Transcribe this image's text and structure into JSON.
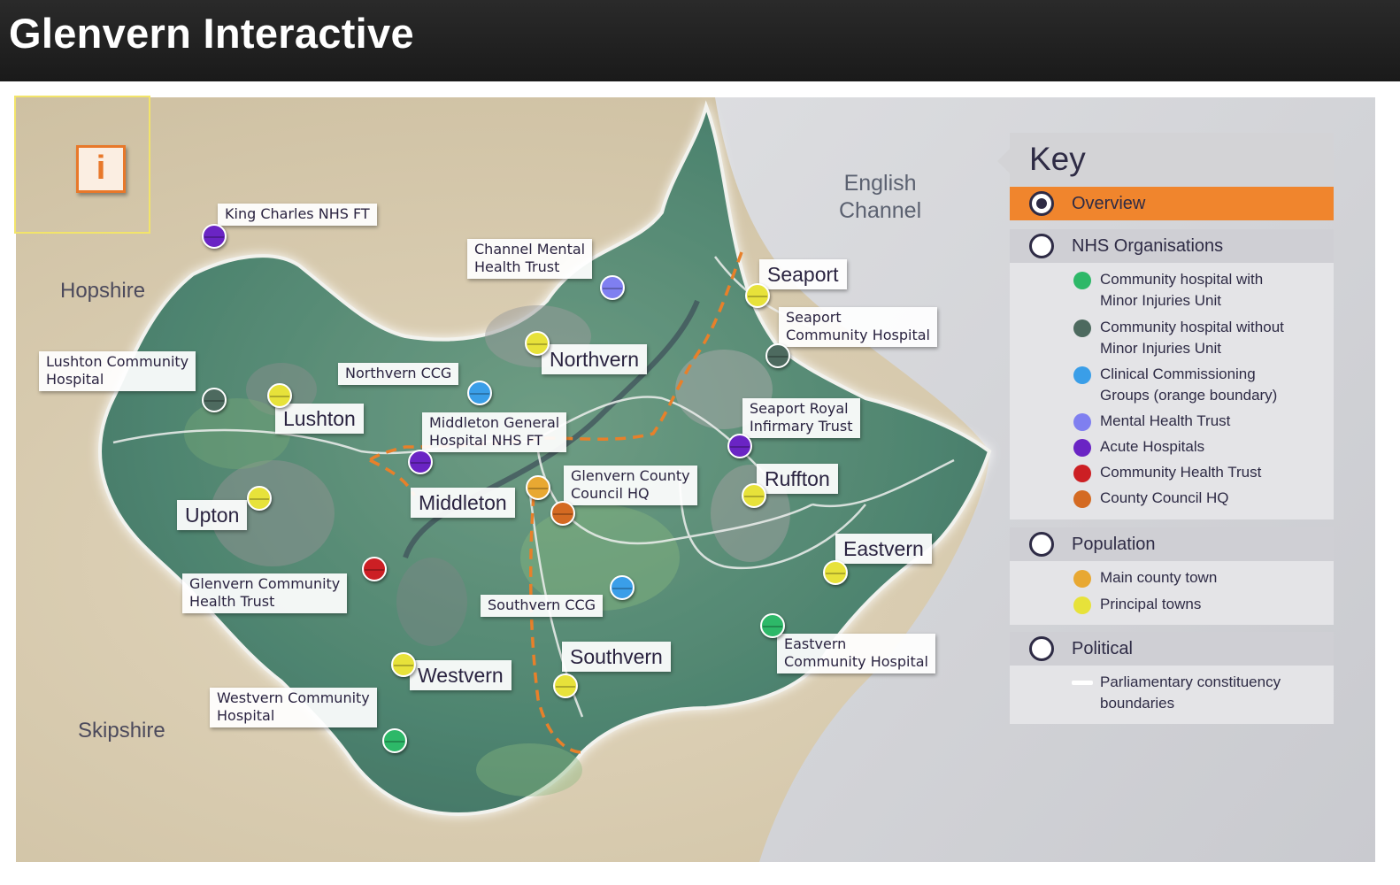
{
  "app": {
    "title": "Glenvern Interactive"
  },
  "map": {
    "info_button": "i",
    "sea_label": [
      "English",
      "Channel"
    ],
    "regions": {
      "hopshire": "Hopshire",
      "skipshire": "Skipshire"
    },
    "towns": {
      "seaport": "Seaport",
      "northvern": "Northvern",
      "lushton": "Lushton",
      "middleton": "Middleton",
      "upton": "Upton",
      "ruffton": "Ruffton",
      "eastvern": "Eastvern",
      "southvern": "Southvern",
      "westvern": "Westvern"
    },
    "orgs": {
      "king_charles": "King Charles NHS FT",
      "channel_mental": [
        "Channel Mental",
        "Health Trust"
      ],
      "seaport_community": [
        "Seaport",
        "Community Hospital"
      ],
      "lushton_community": [
        "Lushton Community",
        "Hospital"
      ],
      "northvern_ccg": "Northvern CCG",
      "middleton_general": [
        "Middleton General",
        "Hospital  NHS FT"
      ],
      "seaport_royal": [
        "Seaport Royal",
        "Infirmary Trust"
      ],
      "glenvern_county": [
        "Glenvern County",
        "Council HQ"
      ],
      "glenvern_community": [
        "Glenvern Community",
        "Health Trust"
      ],
      "southvern_ccg": "Southvern CCG",
      "eastvern_community": [
        "Eastvern",
        "Community Hospital"
      ],
      "westvern_community": [
        "Westvern Community",
        "Hospital"
      ]
    }
  },
  "key": {
    "title": "Key",
    "sections": {
      "overview": "Overview",
      "nhs": "NHS Organisations",
      "population": "Population",
      "political": "Political"
    },
    "nhs_items": [
      {
        "lines": [
          "Community hospital with",
          "Minor Injuries Unit"
        ],
        "color": "#2db868"
      },
      {
        "lines": [
          "Community hospital without",
          "Minor Injuries Unit"
        ],
        "color": "#4d6a5f"
      },
      {
        "lines": [
          "Clinical Commissioning",
          "Groups (orange boundary)"
        ],
        "color": "#3a9ee8"
      },
      {
        "lines": [
          "Mental Health Trust"
        ],
        "color": "#7f7ff0"
      },
      {
        "lines": [
          "Acute Hospitals"
        ],
        "color": "#6a24c4"
      },
      {
        "lines": [
          "Community Health Trust"
        ],
        "color": "#cc1f24"
      },
      {
        "lines": [
          "County Council HQ"
        ],
        "color": "#d46a22"
      }
    ],
    "population_items": [
      {
        "lines": [
          "Main county town"
        ],
        "color": "#e8a832"
      },
      {
        "lines": [
          "Principal towns"
        ],
        "color": "#e7e23a"
      }
    ],
    "political_items": [
      {
        "lines": [
          "Parliamentary constituency",
          "boundaries"
        ],
        "color": "#ffffff"
      }
    ]
  },
  "colors": {
    "accent": "#f0852d",
    "title_bar": "#1f1f1f",
    "principal_town": "#e7e23a",
    "main_town": "#e8a832",
    "ccg": "#3a9ee8",
    "mental_health": "#7f7ff0",
    "acute": "#6a24c4",
    "community_health": "#cc1f24",
    "council_hq": "#d46a22",
    "hospital_miu": "#2db868",
    "hospital_no_miu": "#4d6a5f"
  }
}
